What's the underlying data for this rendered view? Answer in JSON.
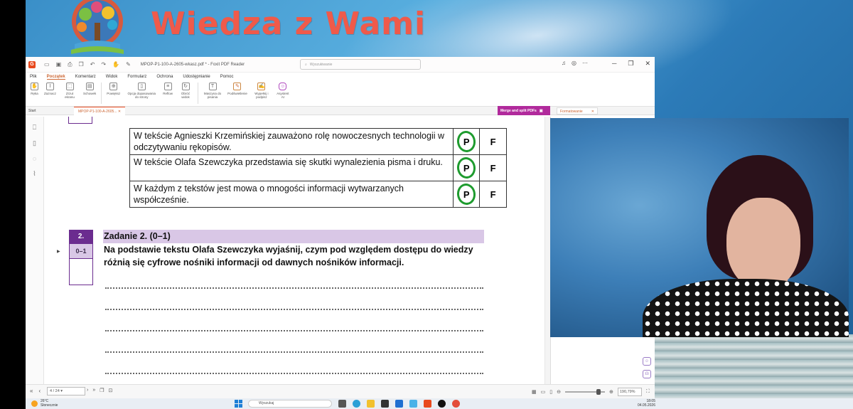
{
  "branding": {
    "title": "Wiedza z Wami"
  },
  "window": {
    "title": "MPOP-P1-100-A-2605-wkasz.pdf * - Foxit PDF Reader",
    "search_placeholder": "Wyszukiwanie"
  },
  "menu": [
    "Plik",
    "Początek",
    "Komentarz",
    "Widok",
    "Formularz",
    "Ochrona",
    "Udostępnianie",
    "Pomoc"
  ],
  "menu_active": "Początek",
  "ribbon": [
    {
      "label": "Ręka",
      "icon": "hand-icon"
    },
    {
      "label": "Zaznacz",
      "icon": "select-icon"
    },
    {
      "label": "Zrzut ekranu",
      "icon": "screenshot-icon"
    },
    {
      "label": "Schowek",
      "icon": "clipboard-icon"
    },
    {
      "label": "Powiększ",
      "icon": "zoom-icon"
    },
    {
      "label": "Opcja dopasowania do strony",
      "icon": "fit-page-icon"
    },
    {
      "label": "Reflow",
      "icon": "reflow-icon"
    },
    {
      "label": "Obróć widok",
      "icon": "rotate-icon"
    },
    {
      "label": "Maszyna do pisania",
      "icon": "typewriter-icon"
    },
    {
      "label": "Podświetlenie",
      "icon": "highlight-icon"
    },
    {
      "label": "Wypełnij i podpisz",
      "icon": "sign-icon"
    },
    {
      "label": "Asystent AI",
      "icon": "ai-assistant-icon"
    }
  ],
  "tabs": {
    "start": "Start",
    "document": "MPOP-P1-100-A-2605...",
    "merge": "Merge and split PDFs",
    "panel": "Formatowanie"
  },
  "pdf": {
    "statements": [
      {
        "text": "W tekście Agnieszki Krzemińskiej zauważono rolę nowoczesnych technologii w odczytywaniu rękopisów.",
        "p": "P",
        "f": "F"
      },
      {
        "text": "W tekście Olafa Szewczyka przedstawia się skutki wynalezienia pisma i druku.",
        "p": "P",
        "f": "F"
      },
      {
        "text": "W każdym z tekstów jest mowa o mnogości informacji wytwarzanych współcześnie.",
        "p": "P",
        "f": "F"
      }
    ],
    "task": {
      "number": "2.",
      "score": "0–1",
      "header": "Zadanie 2. (0–1)",
      "body": "Na podstawie tekstu Olafa Szewczyka wyjaśnij, czym pod względem dostępu do wiedzy różnią się cyfrowe nośniki informacji od dawnych nośników informacji."
    }
  },
  "statusbar": {
    "page": "4 / 24",
    "zoom": "190,79%"
  },
  "taskbar": {
    "temperature": "26°C",
    "weather": "Słonecznie",
    "search": "Wyszukaj",
    "time": "18:05",
    "date": "04.05.2026"
  },
  "colors": {
    "brand": "#ef5a4a",
    "accent": "#e8491d",
    "task_purple": "#6b2c8f",
    "task_light": "#d9c7e6",
    "check_green": "#1e9b2e"
  }
}
